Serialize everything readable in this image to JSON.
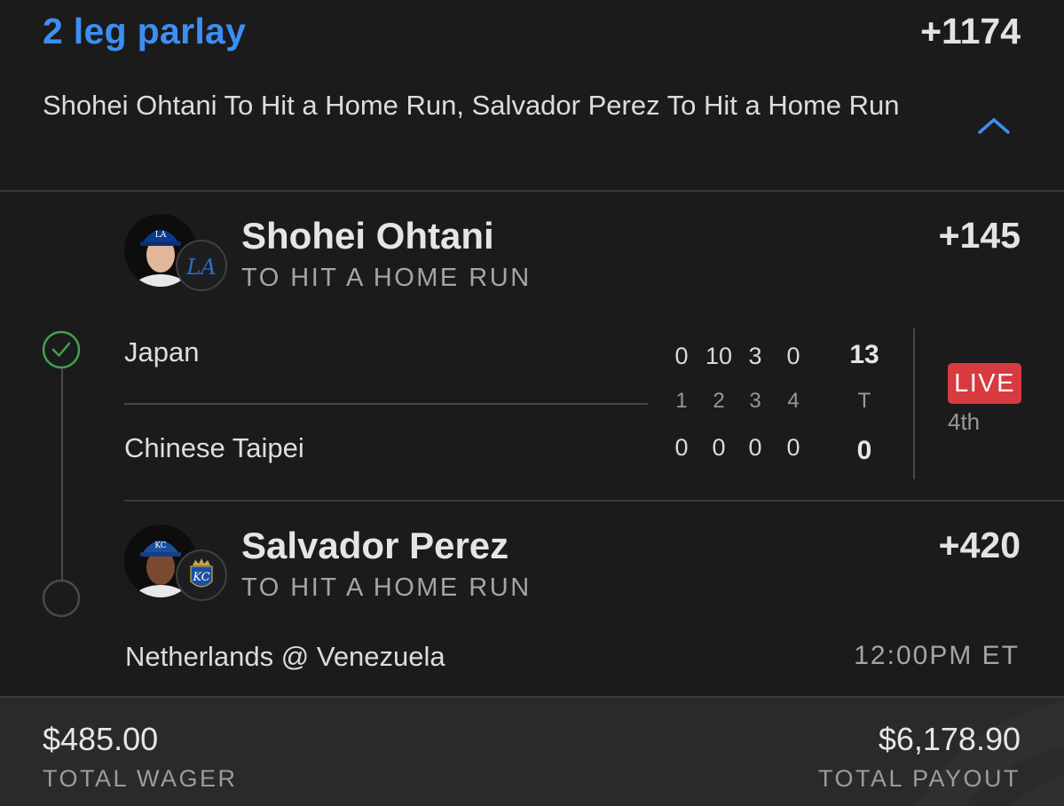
{
  "parlay": {
    "title": "2 leg parlay",
    "odds": "+1174",
    "description": "Shohei Ohtani To Hit a Home Run, Salvador Perez To Hit a Home Run"
  },
  "legs": [
    {
      "player": "Shohei Ohtani",
      "team_logo": "LA",
      "market": "TO HIT A HOME RUN",
      "odds": "+145",
      "status_icon": "check-circle-icon",
      "game": {
        "home_team": "Japan",
        "away_team": "Chinese Taipei",
        "innings": [
          "1",
          "2",
          "3",
          "4"
        ],
        "home_scores": [
          "0",
          "10",
          "3",
          "0"
        ],
        "away_scores": [
          "0",
          "0",
          "0",
          "0"
        ],
        "total_label": "T",
        "home_total": "13",
        "away_total": "0",
        "live_label": "LIVE",
        "period": "4th"
      }
    },
    {
      "player": "Salvador Perez",
      "team_logo": "KC",
      "team_logo_top": "KC",
      "market": "TO HIT A HOME RUN",
      "odds": "+420",
      "status_icon": "pending-circle-icon",
      "game": {
        "matchup": "Netherlands @ Venezuela",
        "time": "12:00PM ET"
      }
    }
  ],
  "footer": {
    "wager_amount": "$485.00",
    "wager_label": "TOTAL WAGER",
    "payout_amount": "$6,178.90",
    "payout_label": "TOTAL PAYOUT"
  },
  "colors": {
    "accent": "#3c8ff2",
    "success": "#3fa34d",
    "live": "#d73a3f",
    "background": "#1b1b1c"
  }
}
